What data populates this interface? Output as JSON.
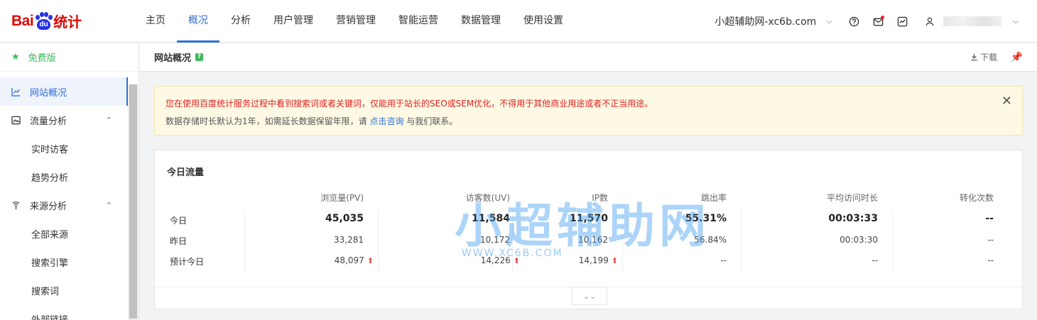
{
  "logo": {
    "bai": "Bai",
    "du": "du",
    "tongji": "统计"
  },
  "nav": [
    "主页",
    "概况",
    "分析",
    "用户管理",
    "营销管理",
    "智能运营",
    "数据管理",
    "使用设置"
  ],
  "nav_active": 1,
  "site": "小超辅助网-xc6b.com",
  "icons": [
    "help-icon",
    "mail-icon",
    "chart-box-icon",
    "user-icon"
  ],
  "sidebar": {
    "free": "免费版",
    "items": [
      {
        "label": "网站概况",
        "icon": "line-chart-icon",
        "active": true
      },
      {
        "label": "流量分析",
        "icon": "picture-icon",
        "caret": true
      },
      {
        "label": "实时访客",
        "sub": true
      },
      {
        "label": "趋势分析",
        "sub": true
      },
      {
        "label": "来源分析",
        "icon": "signal-icon",
        "caret": true
      },
      {
        "label": "全部来源",
        "sub": true
      },
      {
        "label": "搜索引擎",
        "sub": true
      },
      {
        "label": "搜索词",
        "sub": true
      },
      {
        "label": "外部链接",
        "sub": true
      }
    ]
  },
  "page": {
    "title": "网站概况",
    "download": "下载"
  },
  "notice": {
    "line1": "您在使用百度统计服务过程中看到搜索词或者关键词，仅能用于站长的SEO或SEM优化，不得用于其他商业用途或者不正当用途。",
    "line2_pre": "数据存储时长默认为1年，如需延长数据保留年限，请 ",
    "line2_link": "点击咨询",
    "line2_post": " 与我们联系。"
  },
  "traffic": {
    "title": "今日流量",
    "headers": [
      "浏览量(PV)",
      "访客数(UV)",
      "IP数",
      "跳出率",
      "平均访问时长",
      "转化次数"
    ],
    "rows": [
      {
        "label": "今日",
        "values": [
          "45,035",
          "11,584",
          "11,570",
          "55.31%",
          "00:03:33",
          "--"
        ]
      },
      {
        "label": "昨日",
        "values": [
          "33,281",
          "10,172",
          "10,162",
          "56.84%",
          "00:03:30",
          "--"
        ]
      },
      {
        "label": "预计今日",
        "values": [
          "48,097",
          "14,226",
          "14,199",
          "--",
          "--",
          "--"
        ],
        "up": [
          true,
          true,
          true,
          false,
          false,
          false
        ]
      }
    ]
  },
  "watermark": {
    "main": "小超辅助网",
    "sub": "WWW.XC6B.COM"
  }
}
